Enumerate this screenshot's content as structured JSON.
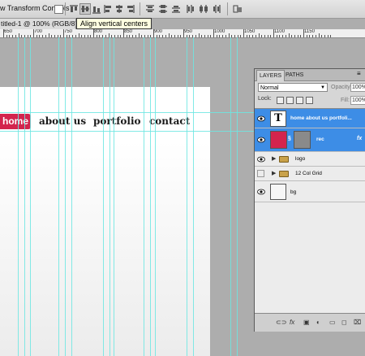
{
  "options_bar": {
    "transform_label": "w Transform Controls",
    "tooltip": "Align vertical centers"
  },
  "document": {
    "tab_title": "titled-1 @ 100% (RGB/8)"
  },
  "ruler": {
    "labels": [
      "650",
      "700",
      "750",
      "800",
      "850",
      "900",
      "950",
      "1000",
      "1050",
      "1100",
      "1150"
    ]
  },
  "canvas": {
    "nav": {
      "home": "home",
      "about": "about us",
      "portfolio": "portfolio",
      "contact": "contact"
    }
  },
  "layers_panel": {
    "tabs": [
      "LAYERS",
      "PATHS"
    ],
    "blend_mode": "Normal",
    "opacity_label": "Opacity:",
    "opacity_value": "100%",
    "lock_label": "Lock:",
    "fill_label": "Fill:",
    "fill_value": "100%",
    "layers": [
      {
        "name": "home  about us  portfoli...",
        "type": "text",
        "thumb": "T",
        "selected": true
      },
      {
        "name": "rec",
        "type": "shape",
        "selected": true,
        "fx": "fx",
        "colors": {
          "swatch": "#d3244d",
          "mask": "#8a8a8a"
        }
      },
      {
        "name": "logo",
        "type": "group",
        "selected": false
      },
      {
        "name": "12 Col Grid",
        "type": "group",
        "selected": false
      },
      {
        "name": "bg",
        "type": "pixel",
        "selected": false
      }
    ],
    "footer_icons": [
      "link-icon",
      "fx-icon",
      "mask-icon",
      "adjustment-icon",
      "group-icon",
      "new-layer-icon",
      "trash-icon"
    ]
  },
  "colors": {
    "accent": "#d3244d",
    "selection": "#3d8de6",
    "guide": "#6ce6e2"
  }
}
